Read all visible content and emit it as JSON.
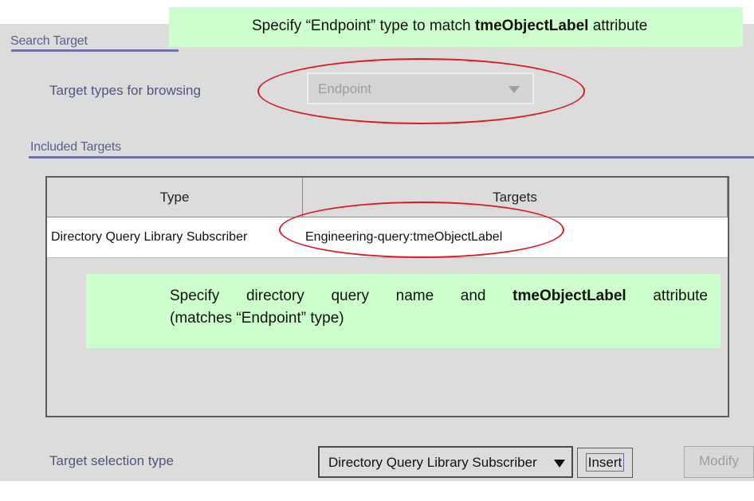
{
  "sections": {
    "search_target": "Search Target",
    "included_targets": "Included Targets"
  },
  "target_types": {
    "label": "Target types for browsing",
    "value": "Endpoint"
  },
  "table": {
    "columns": [
      "Type",
      "Targets"
    ],
    "rows": [
      {
        "type": "Directory Query Library Subscriber",
        "targets": "Engineering-query:tmeObjectLabel"
      }
    ]
  },
  "selection": {
    "label": "Target selection type",
    "value": "Directory Query Library Subscriber"
  },
  "buttons": {
    "insert": "Insert",
    "modify": "Modify"
  },
  "callouts": {
    "top": {
      "prefix": "Specify “Endpoint” type to match ",
      "bold": "tmeObjectLabel",
      "suffix": " attribute"
    },
    "middle": {
      "line1_prefix": "Specify directory query name and ",
      "line1_bold": "tmeObjectLabel",
      "line1_suffix": " attribute",
      "line2": "(matches “Endpoint” type)"
    }
  },
  "colors": {
    "panel": "#dcdcdc",
    "callout": "#ccffcc",
    "highlight_ellipse": "#e0191f",
    "section_text": "#5a5f8f"
  }
}
